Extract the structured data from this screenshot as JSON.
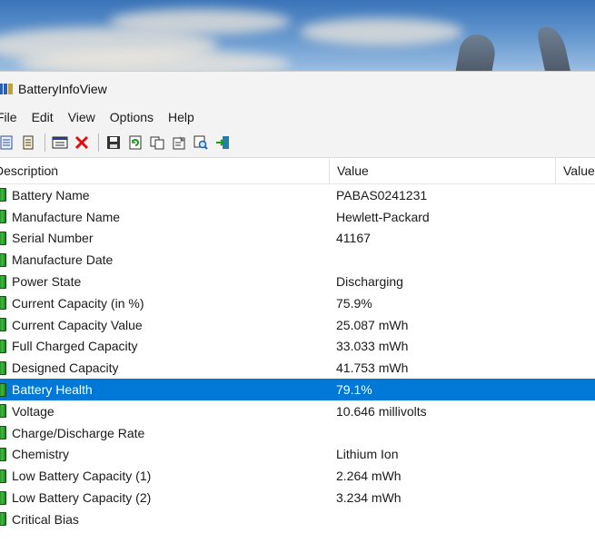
{
  "window": {
    "title": "BatteryInfoView"
  },
  "menu": [
    "File",
    "Edit",
    "View",
    "Options",
    "Help"
  ],
  "toolbar_icons": [
    "html-report-icon",
    "text-report-icon",
    "properties-window-icon",
    "delete-icon",
    "save-icon",
    "refresh-icon",
    "copy-icon",
    "options-icon",
    "find-icon",
    "exit-icon"
  ],
  "columns": {
    "description": "Description",
    "value": "Value",
    "value2": "Value"
  },
  "rows": [
    {
      "label": "Battery Name",
      "value": "PABAS0241231"
    },
    {
      "label": "Manufacture Name",
      "value": "Hewlett-Packard"
    },
    {
      "label": "Serial Number",
      "value": "41167"
    },
    {
      "label": "Manufacture Date",
      "value": ""
    },
    {
      "label": "Power State",
      "value": "Discharging"
    },
    {
      "label": "Current Capacity (in %)",
      "value": "75.9%"
    },
    {
      "label": "Current Capacity Value",
      "value": "25.087 mWh"
    },
    {
      "label": "Full Charged Capacity",
      "value": "33.033 mWh"
    },
    {
      "label": "Designed Capacity",
      "value": "41.753 mWh"
    },
    {
      "label": "Battery Health",
      "value": "79.1%"
    },
    {
      "label": "Voltage",
      "value": "10.646 millivolts"
    },
    {
      "label": "Charge/Discharge Rate",
      "value": ""
    },
    {
      "label": "Chemistry",
      "value": "Lithium Ion"
    },
    {
      "label": "Low Battery Capacity (1)",
      "value": "2.264 mWh"
    },
    {
      "label": "Low Battery Capacity (2)",
      "value": "3.234 mWh"
    },
    {
      "label": "Critical Bias",
      "value": ""
    }
  ],
  "selected_row": "Battery Health",
  "colors": {
    "selection": "#0078d7",
    "battery_icon": "#3fbf3f"
  }
}
